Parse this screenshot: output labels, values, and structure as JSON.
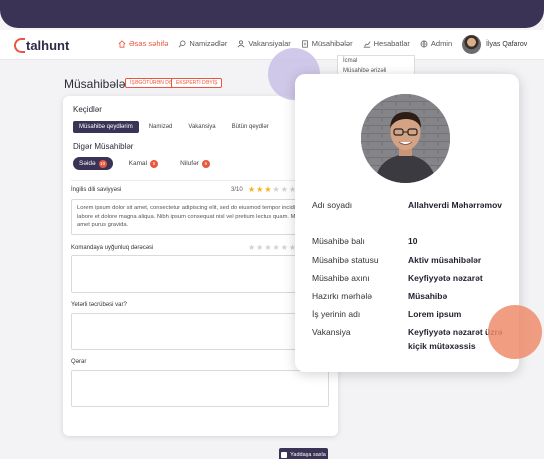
{
  "brand": {
    "logo_text": "talhunt",
    "accent": "#e8573e",
    "dark": "#3a3355"
  },
  "nav": {
    "items": [
      {
        "label": "Əsas səhifə",
        "icon": "home-icon",
        "active": true
      },
      {
        "label": "Namizədlər",
        "icon": "search-icon",
        "active": false
      },
      {
        "label": "Vakansiyalar",
        "icon": "people-icon",
        "active": false
      },
      {
        "label": "Müsahibələr",
        "icon": "document-icon",
        "active": false
      },
      {
        "label": "Hesabatlar",
        "icon": "chart-icon",
        "active": false
      },
      {
        "label": "Admin",
        "icon": "globe-icon",
        "active": false
      }
    ],
    "user_name": "İlyas Qafarov",
    "dropdown_items": [
      "İcmal",
      "Müsahibə ərizəli"
    ]
  },
  "page": {
    "title": "Müsahibələr",
    "pill_1": "İŞƏGÖTÜRƏN DƏYİŞ",
    "pill_2": "EKSPERTİ DƏYİŞ"
  },
  "panel": {
    "transitions_label": "Keçidlər",
    "tabs": [
      "Müsahibə qeydlərim",
      "Namizəd",
      "Vakansiya",
      "Bütün qeydlər"
    ],
    "other_label": "Digər Müsahiblər",
    "chips": [
      {
        "label": "Səidə",
        "badge": "10",
        "active": true
      },
      {
        "label": "Kamal",
        "badge": "5",
        "active": false
      },
      {
        "label": "Nilufər",
        "badge": "6",
        "active": false
      }
    ],
    "criteria": [
      {
        "label": "İngilis dili saviyyəsi",
        "score": "3/10",
        "stars_on": 3,
        "text": "Lorem ipsum dolor sit amet, consectetur adipiscing elit, sed do eiusmod tempor incididunt ut labore et dolore magna aliqua. Nibh ipsum consequat nisl vel pretium lectus quam. Magna sit amet purus gravida."
      },
      {
        "label": "Komandaya uyğunluq dərəcəsi",
        "score": "",
        "stars_on": 0,
        "text": ""
      },
      {
        "label": "Yetərli təcrübəsi var?",
        "score": "",
        "stars_on": 0,
        "text": ""
      },
      {
        "label": "Qərar",
        "score": "",
        "stars_on": 0,
        "text": ""
      }
    ],
    "save_label": "Yaddaşa saxla"
  },
  "profile": {
    "rows": [
      {
        "label": "Adı soyadı",
        "value": "Allahverdi Məhərrəmov"
      },
      {
        "label": "Müsahibə balı",
        "value": "10"
      },
      {
        "label": "Müsahibə statusu",
        "value": "Aktiv müsahibələr"
      },
      {
        "label": "Müsahibə axını",
        "value": "Keyfiyyətə nəzarət"
      },
      {
        "label": "Hazırkı mərhələ",
        "value": "Müsahibə"
      },
      {
        "label": "İş yerinin adı",
        "value": "Lorem ipsum"
      },
      {
        "label": "Vakansiya",
        "value": "Keyfiyyətə nəzarət üzrə kiçik mütəxəssis"
      }
    ]
  }
}
